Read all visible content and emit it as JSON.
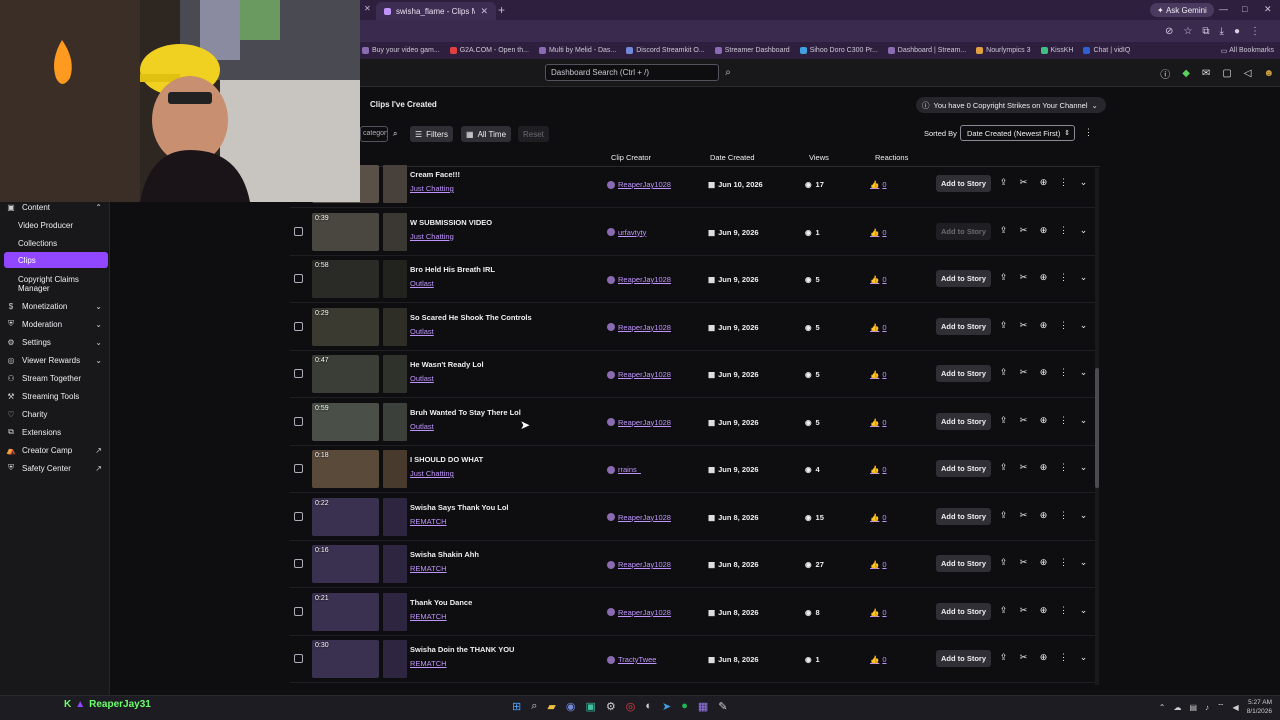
{
  "browser": {
    "tab_title": "swisha_flame - Clips Manager",
    "ask_label": "Ask Gemini",
    "bookmarks": [
      "Buy your video gam...",
      "G2A.COM - Open th...",
      "Multi by Melid - Das...",
      "Discord Streamkit O...",
      "Streamer Dashboard",
      "Sihoo Doro C300 Pr...",
      "Dashboard | Stream...",
      "Nourlympics 3",
      "KissKH",
      "Chat | vidIQ"
    ],
    "all_bookmarks": "All Bookmarks"
  },
  "topbar": {
    "search_placeholder": "Dashboard Search (Ctrl + /)"
  },
  "sidebar": {
    "content": "Content",
    "video_producer": "Video Producer",
    "collections": "Collections",
    "clips": "Clips",
    "copyright": "Copyright Claims Manager",
    "monetization": "Monetization",
    "moderation": "Moderation",
    "settings": "Settings",
    "viewer_rewards": "Viewer Rewards",
    "stream_together": "Stream Together",
    "streaming_tools": "Streaming Tools",
    "charity": "Charity",
    "extensions": "Extensions",
    "creator_camp": "Creator Camp",
    "safety_center": "Safety Center"
  },
  "main": {
    "title": "Clips I've Created",
    "strikes": "You have 0 Copyright Strikes on Your Channel",
    "search_placeholder": "category",
    "filters": "Filters",
    "all_time": "All Time",
    "reset": "Reset",
    "sorted_by": "Sorted By",
    "sort_value": "Date Created (Newest First)",
    "headers": {
      "creator": "Clip Creator",
      "date": "Date Created",
      "views": "Views",
      "reactions": "Reactions"
    },
    "add_story": "Add to Story"
  },
  "rows": [
    {
      "dur": "",
      "title": "Cream Face!!!",
      "cat": "Just Chatting",
      "creator": "ReaperJay1028",
      "date": "Jun 10, 2026",
      "views": "17",
      "react": "0",
      "story_disabled": false
    },
    {
      "dur": "0:39",
      "title": "W SUBMISSION VIDEO",
      "cat": "Just Chatting",
      "creator": "urfavtyty",
      "date": "Jun 9, 2026",
      "views": "1",
      "react": "0",
      "story_disabled": true
    },
    {
      "dur": "0:58",
      "title": "Bro Held His Breath IRL",
      "cat": "Outlast",
      "creator": "ReaperJay1028",
      "date": "Jun 9, 2026",
      "views": "5",
      "react": "0",
      "story_disabled": false
    },
    {
      "dur": "0:29",
      "title": "So Scared He Shook The Controls",
      "cat": "Outlast",
      "creator": "ReaperJay1028",
      "date": "Jun 9, 2026",
      "views": "5",
      "react": "0",
      "story_disabled": false
    },
    {
      "dur": "0:47",
      "title": "He Wasn't Ready Lol",
      "cat": "Outlast",
      "creator": "ReaperJay1028",
      "date": "Jun 9, 2026",
      "views": "5",
      "react": "0",
      "story_disabled": false
    },
    {
      "dur": "0:59",
      "title": "Bruh Wanted To Stay There Lol",
      "cat": "Outlast",
      "creator": "ReaperJay1028",
      "date": "Jun 9, 2026",
      "views": "5",
      "react": "0",
      "story_disabled": false
    },
    {
      "dur": "0:18",
      "title": "I SHOULD DO WHAT",
      "cat": "Just Chatting",
      "creator": "rrains_",
      "date": "Jun 9, 2026",
      "views": "4",
      "react": "0",
      "story_disabled": false
    },
    {
      "dur": "0:22",
      "title": "Swisha Says Thank You Lol",
      "cat": "REMATCH",
      "creator": "ReaperJay1028",
      "date": "Jun 8, 2026",
      "views": "15",
      "react": "0",
      "story_disabled": false
    },
    {
      "dur": "0:16",
      "title": "Swisha Shakin Ahh",
      "cat": "REMATCH",
      "creator": "ReaperJay1028",
      "date": "Jun 8, 2026",
      "views": "27",
      "react": "0",
      "story_disabled": false
    },
    {
      "dur": "0:21",
      "title": "Thank You Dance",
      "cat": "REMATCH",
      "creator": "ReaperJay1028",
      "date": "Jun 8, 2026",
      "views": "8",
      "react": "0",
      "story_disabled": false
    },
    {
      "dur": "0:30",
      "title": "Swisha Doin the THANK YOU",
      "cat": "REMATCH",
      "creator": "TractyTwee",
      "date": "Jun 8, 2026",
      "views": "1",
      "react": "0",
      "story_disabled": false
    }
  ],
  "taskbar": {
    "username": "ReaperJay31",
    "time": "5:27 AM",
    "date": "8/1/2026"
  },
  "colors": {
    "accent": "#9147ff",
    "link": "#bf94ff",
    "bg": "#0e0e10"
  }
}
